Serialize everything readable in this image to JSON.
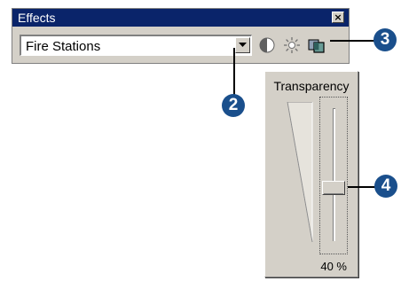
{
  "effects_window": {
    "title": "Effects",
    "close_label": "×",
    "layer_select": {
      "value": "Fire Stations"
    },
    "tools": [
      {
        "icon": "contrast-icon"
      },
      {
        "icon": "brightness-icon"
      },
      {
        "icon": "transparency-icon"
      }
    ]
  },
  "transparency_panel": {
    "title": "Transparency",
    "value_percent": 40,
    "readout": "40 %"
  },
  "callouts": {
    "c2": "2",
    "c3": "3",
    "c4": "4"
  },
  "colors": {
    "title_bar": "#0a246a",
    "panel_face": "#d4d0c8",
    "callout": "#1a4f8c"
  }
}
